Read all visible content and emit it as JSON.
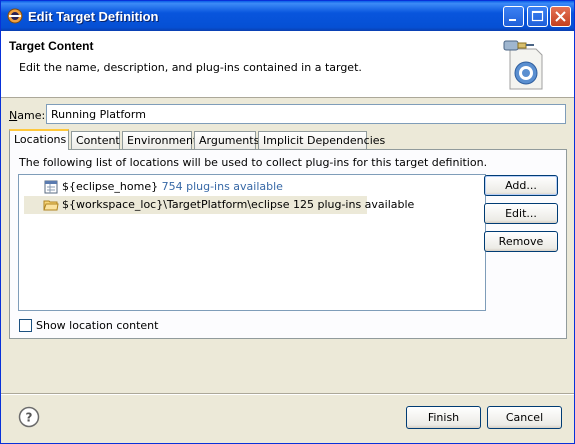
{
  "window": {
    "title": "Edit Target Definition"
  },
  "header": {
    "title": "Target Content",
    "description": "Edit the name, description, and plug-ins contained in a target."
  },
  "name_field": {
    "label": "Name:",
    "value": "Running Platform"
  },
  "tabs": [
    {
      "label": "Locations",
      "active": true
    },
    {
      "label": "Content",
      "active": false
    },
    {
      "label": "Environment",
      "active": false
    },
    {
      "label": "Arguments",
      "active": false
    },
    {
      "label": "Implicit Dependencies",
      "active": false
    }
  ],
  "locations": {
    "description": "The following list of locations will be used to collect plug-ins for this target definition.",
    "items": [
      {
        "path": "${eclipse_home}",
        "status": "754 plug-ins available",
        "icon": "installation-icon",
        "selected": false
      },
      {
        "path": "${workspace_loc}\\TargetPlatform\\eclipse",
        "status": "125 plug-ins available",
        "icon": "folder-icon",
        "selected": true
      }
    ],
    "buttons": {
      "add": "Add...",
      "edit": "Edit...",
      "remove": "Remove"
    },
    "show_content": {
      "label": "Show location content",
      "checked": false
    }
  },
  "footer": {
    "finish": "Finish",
    "cancel": "Cancel"
  },
  "colors": {
    "status_text": "#3768a6",
    "title_bar": "#0855dd",
    "dialog_bg": "#ece9d8"
  }
}
